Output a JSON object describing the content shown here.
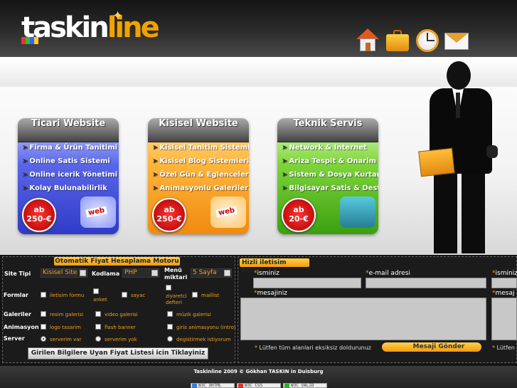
{
  "header": {
    "logo_text_white": "taskin",
    "logo_text_orange": "line",
    "icons": [
      "home-icon",
      "briefcase-icon",
      "clock-icon",
      "mail-icon"
    ]
  },
  "cards": [
    {
      "title": "Ticari Website",
      "features": [
        "Firma & Ürün Tanitimi",
        "Online Satis Sistemi",
        "Online icerik Yönetimi",
        "Kolay Bulunabilirlik"
      ],
      "price_prefix": "ab",
      "price": "250-€",
      "art_label": "web"
    },
    {
      "title": "Kisisel Website",
      "features": [
        "Kisisel Tanitim Sistemleri",
        "Kisisel Blog Sistemleri",
        "Özel Gün & Eglenceler",
        "Animasyonlu Galeriler"
      ],
      "price_prefix": "ab",
      "price": "250-€",
      "art_label": "web"
    },
    {
      "title": "Teknik Servis",
      "features": [
        "Network & Internet",
        "Ariza Tespit & Onarim",
        "Sistem & Dosya Kurtarma",
        "Bilgisayar Satis & Destek"
      ],
      "price_prefix": "ab",
      "price": "20-€",
      "art_label": ""
    }
  ],
  "calculator": {
    "title": "Otomatik Fiyat Hesaplama Motoru",
    "site_tipi_label": "Site Tipi",
    "site_tipi_value": "Kisisel Site",
    "kodlama_label": "Kodlama",
    "kodlama_value": "PHP",
    "menu_label_1": "Menü",
    "menu_label_2": "miktari",
    "menu_value": "5 Sayfa",
    "formlar_label": "Formlar",
    "formlar_options": [
      "iletisim formu",
      "anket",
      "sayac",
      "ziyaretci defteri",
      "maillist"
    ],
    "galeriler_label": "Galeriler",
    "galeriler_options": [
      "resim galerisi",
      "video galerisi",
      "müzik galerisi"
    ],
    "animasyon_label": "Animasyon",
    "animasyon_options": [
      "logo tasarim",
      "flash banner",
      "giris animasyonu (intro)"
    ],
    "server_label": "Server",
    "server_options": [
      "serverim var",
      "serverim yok",
      "degistirmek istiyorum"
    ],
    "server_selected": "serverim var",
    "button_label": "Girilen Bilgilere Uyan Fiyat Listesi icin Tiklayiniz"
  },
  "contact": {
    "title": "Hizli iletisim Formu",
    "name_label": "isminiz",
    "email_label": "e-mail adresi",
    "name_label_right": "isminiz",
    "message_label": "mesajiniz",
    "message_label_right": "mesaj",
    "note": "Lütfen tüm alanlari eksiksiz doldurunuz",
    "note_right": "Lütfen",
    "send_label": "Mesaji Gönder",
    "asterisk": "*"
  },
  "footer": {
    "copyright": "Taskinline 2009 © Gökhan TASKIN in Duisburg",
    "badges": [
      "W3C XHTML",
      "W3C CSS",
      "W3C VALID"
    ]
  },
  "colors": {
    "accent": "#f29a10",
    "panel_bg": "#141414"
  }
}
